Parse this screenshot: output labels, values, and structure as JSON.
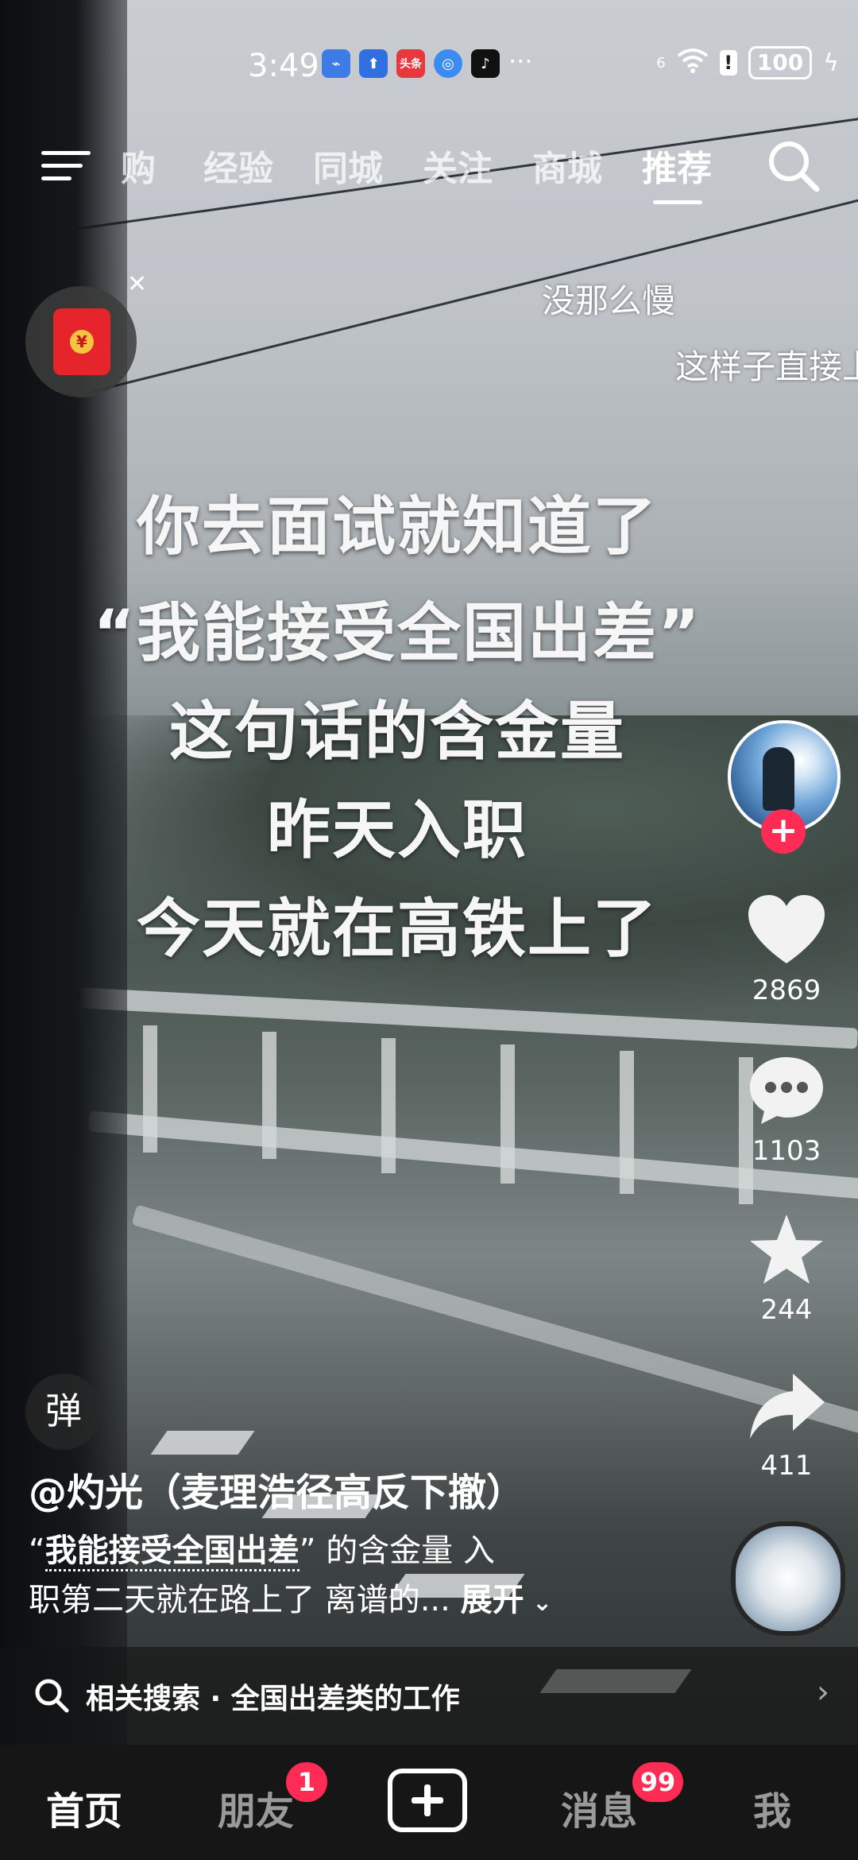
{
  "status_bar": {
    "time": "3:49",
    "app_icons": [
      "usb-icon",
      "upload-icon",
      "toutiao-icon",
      "browser-icon",
      "tiktok-icon"
    ],
    "toutiao_label": "头条",
    "more": "···",
    "signal_label": "6",
    "battery": "100"
  },
  "top_nav": {
    "tabs": [
      "购",
      "经验",
      "同城",
      "关注",
      "商城",
      "推荐"
    ],
    "active_tab": "推荐"
  },
  "danmaku": [
    "没那么慢",
    "这样子直接上"
  ],
  "caption_lines": [
    "你去面试就知道了",
    "“我能接受全国出差”",
    "这句话的含金量",
    "昨天入职",
    "今天就在高铁上了"
  ],
  "actions": {
    "like_count": "2869",
    "comment_count": "1103",
    "favorite_count": "244",
    "share_count": "411"
  },
  "danmu_button": "弹",
  "author": "@灼光（麦理浩径高反下撤）",
  "description": {
    "quote_open": "“",
    "highlight": "我能接受全国出差",
    "quote_close": "”",
    "rest_line1": "的含金量 入",
    "line2": "职第二天就在路上了 离谱的...",
    "expand": "展开"
  },
  "related_search": {
    "label": "相关搜索 · 全国出差类的工作"
  },
  "bottom_nav": {
    "home": "首页",
    "friends": "朋友",
    "friends_badge": "1",
    "messages": "消息",
    "messages_badge": "99",
    "me": "我"
  },
  "colors": {
    "accent": "#fe2c55",
    "nav_bg": "#161616"
  }
}
